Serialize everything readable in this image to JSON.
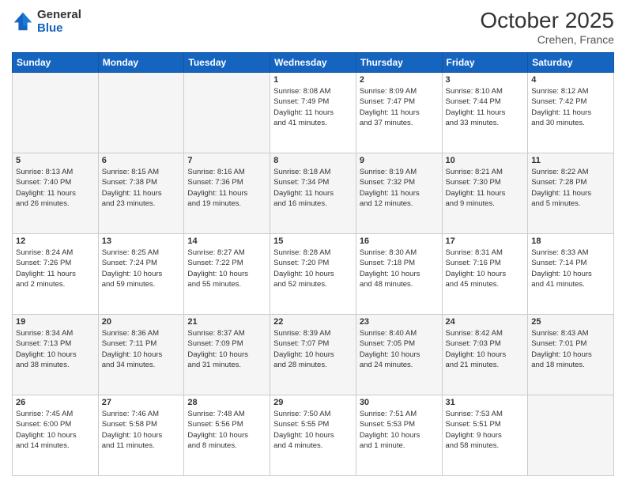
{
  "header": {
    "logo_line1": "General",
    "logo_line2": "Blue",
    "month_year": "October 2025",
    "location": "Crehen, France"
  },
  "days_of_week": [
    "Sunday",
    "Monday",
    "Tuesday",
    "Wednesday",
    "Thursday",
    "Friday",
    "Saturday"
  ],
  "weeks": [
    [
      {
        "day": "",
        "info": ""
      },
      {
        "day": "",
        "info": ""
      },
      {
        "day": "",
        "info": ""
      },
      {
        "day": "1",
        "info": "Sunrise: 8:08 AM\nSunset: 7:49 PM\nDaylight: 11 hours\nand 41 minutes."
      },
      {
        "day": "2",
        "info": "Sunrise: 8:09 AM\nSunset: 7:47 PM\nDaylight: 11 hours\nand 37 minutes."
      },
      {
        "day": "3",
        "info": "Sunrise: 8:10 AM\nSunset: 7:44 PM\nDaylight: 11 hours\nand 33 minutes."
      },
      {
        "day": "4",
        "info": "Sunrise: 8:12 AM\nSunset: 7:42 PM\nDaylight: 11 hours\nand 30 minutes."
      }
    ],
    [
      {
        "day": "5",
        "info": "Sunrise: 8:13 AM\nSunset: 7:40 PM\nDaylight: 11 hours\nand 26 minutes."
      },
      {
        "day": "6",
        "info": "Sunrise: 8:15 AM\nSunset: 7:38 PM\nDaylight: 11 hours\nand 23 minutes."
      },
      {
        "day": "7",
        "info": "Sunrise: 8:16 AM\nSunset: 7:36 PM\nDaylight: 11 hours\nand 19 minutes."
      },
      {
        "day": "8",
        "info": "Sunrise: 8:18 AM\nSunset: 7:34 PM\nDaylight: 11 hours\nand 16 minutes."
      },
      {
        "day": "9",
        "info": "Sunrise: 8:19 AM\nSunset: 7:32 PM\nDaylight: 11 hours\nand 12 minutes."
      },
      {
        "day": "10",
        "info": "Sunrise: 8:21 AM\nSunset: 7:30 PM\nDaylight: 11 hours\nand 9 minutes."
      },
      {
        "day": "11",
        "info": "Sunrise: 8:22 AM\nSunset: 7:28 PM\nDaylight: 11 hours\nand 5 minutes."
      }
    ],
    [
      {
        "day": "12",
        "info": "Sunrise: 8:24 AM\nSunset: 7:26 PM\nDaylight: 11 hours\nand 2 minutes."
      },
      {
        "day": "13",
        "info": "Sunrise: 8:25 AM\nSunset: 7:24 PM\nDaylight: 10 hours\nand 59 minutes."
      },
      {
        "day": "14",
        "info": "Sunrise: 8:27 AM\nSunset: 7:22 PM\nDaylight: 10 hours\nand 55 minutes."
      },
      {
        "day": "15",
        "info": "Sunrise: 8:28 AM\nSunset: 7:20 PM\nDaylight: 10 hours\nand 52 minutes."
      },
      {
        "day": "16",
        "info": "Sunrise: 8:30 AM\nSunset: 7:18 PM\nDaylight: 10 hours\nand 48 minutes."
      },
      {
        "day": "17",
        "info": "Sunrise: 8:31 AM\nSunset: 7:16 PM\nDaylight: 10 hours\nand 45 minutes."
      },
      {
        "day": "18",
        "info": "Sunrise: 8:33 AM\nSunset: 7:14 PM\nDaylight: 10 hours\nand 41 minutes."
      }
    ],
    [
      {
        "day": "19",
        "info": "Sunrise: 8:34 AM\nSunset: 7:13 PM\nDaylight: 10 hours\nand 38 minutes."
      },
      {
        "day": "20",
        "info": "Sunrise: 8:36 AM\nSunset: 7:11 PM\nDaylight: 10 hours\nand 34 minutes."
      },
      {
        "day": "21",
        "info": "Sunrise: 8:37 AM\nSunset: 7:09 PM\nDaylight: 10 hours\nand 31 minutes."
      },
      {
        "day": "22",
        "info": "Sunrise: 8:39 AM\nSunset: 7:07 PM\nDaylight: 10 hours\nand 28 minutes."
      },
      {
        "day": "23",
        "info": "Sunrise: 8:40 AM\nSunset: 7:05 PM\nDaylight: 10 hours\nand 24 minutes."
      },
      {
        "day": "24",
        "info": "Sunrise: 8:42 AM\nSunset: 7:03 PM\nDaylight: 10 hours\nand 21 minutes."
      },
      {
        "day": "25",
        "info": "Sunrise: 8:43 AM\nSunset: 7:01 PM\nDaylight: 10 hours\nand 18 minutes."
      }
    ],
    [
      {
        "day": "26",
        "info": "Sunrise: 7:45 AM\nSunset: 6:00 PM\nDaylight: 10 hours\nand 14 minutes."
      },
      {
        "day": "27",
        "info": "Sunrise: 7:46 AM\nSunset: 5:58 PM\nDaylight: 10 hours\nand 11 minutes."
      },
      {
        "day": "28",
        "info": "Sunrise: 7:48 AM\nSunset: 5:56 PM\nDaylight: 10 hours\nand 8 minutes."
      },
      {
        "day": "29",
        "info": "Sunrise: 7:50 AM\nSunset: 5:55 PM\nDaylight: 10 hours\nand 4 minutes."
      },
      {
        "day": "30",
        "info": "Sunrise: 7:51 AM\nSunset: 5:53 PM\nDaylight: 10 hours\nand 1 minute."
      },
      {
        "day": "31",
        "info": "Sunrise: 7:53 AM\nSunset: 5:51 PM\nDaylight: 9 hours\nand 58 minutes."
      },
      {
        "day": "",
        "info": ""
      }
    ]
  ]
}
